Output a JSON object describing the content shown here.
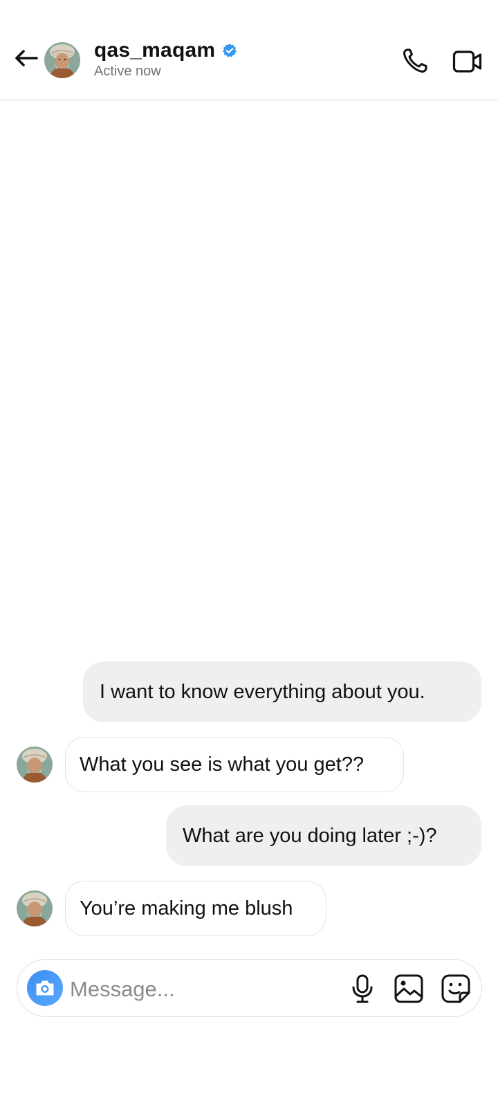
{
  "header": {
    "username": "qas_maqam",
    "status": "Active now",
    "verified": true,
    "icons": {
      "back": "back-arrow-icon",
      "verified": "verified-badge-icon",
      "call": "phone-icon",
      "video": "video-camera-icon"
    },
    "verified_color": "#3897f0"
  },
  "messages": [
    {
      "sender": "me",
      "text": "I want to know everything about you."
    },
    {
      "sender": "them",
      "text": "What you see is what you get??"
    },
    {
      "sender": "me",
      "text": "What are you doing later ;-)?"
    },
    {
      "sender": "them",
      "text": "You’re making me blush"
    }
  ],
  "composer": {
    "placeholder": "Message...",
    "icons": {
      "camera": "camera-icon",
      "mic": "microphone-icon",
      "gallery": "image-icon",
      "sticker": "sticker-icon"
    },
    "camera_color": "#3a8ff2"
  }
}
